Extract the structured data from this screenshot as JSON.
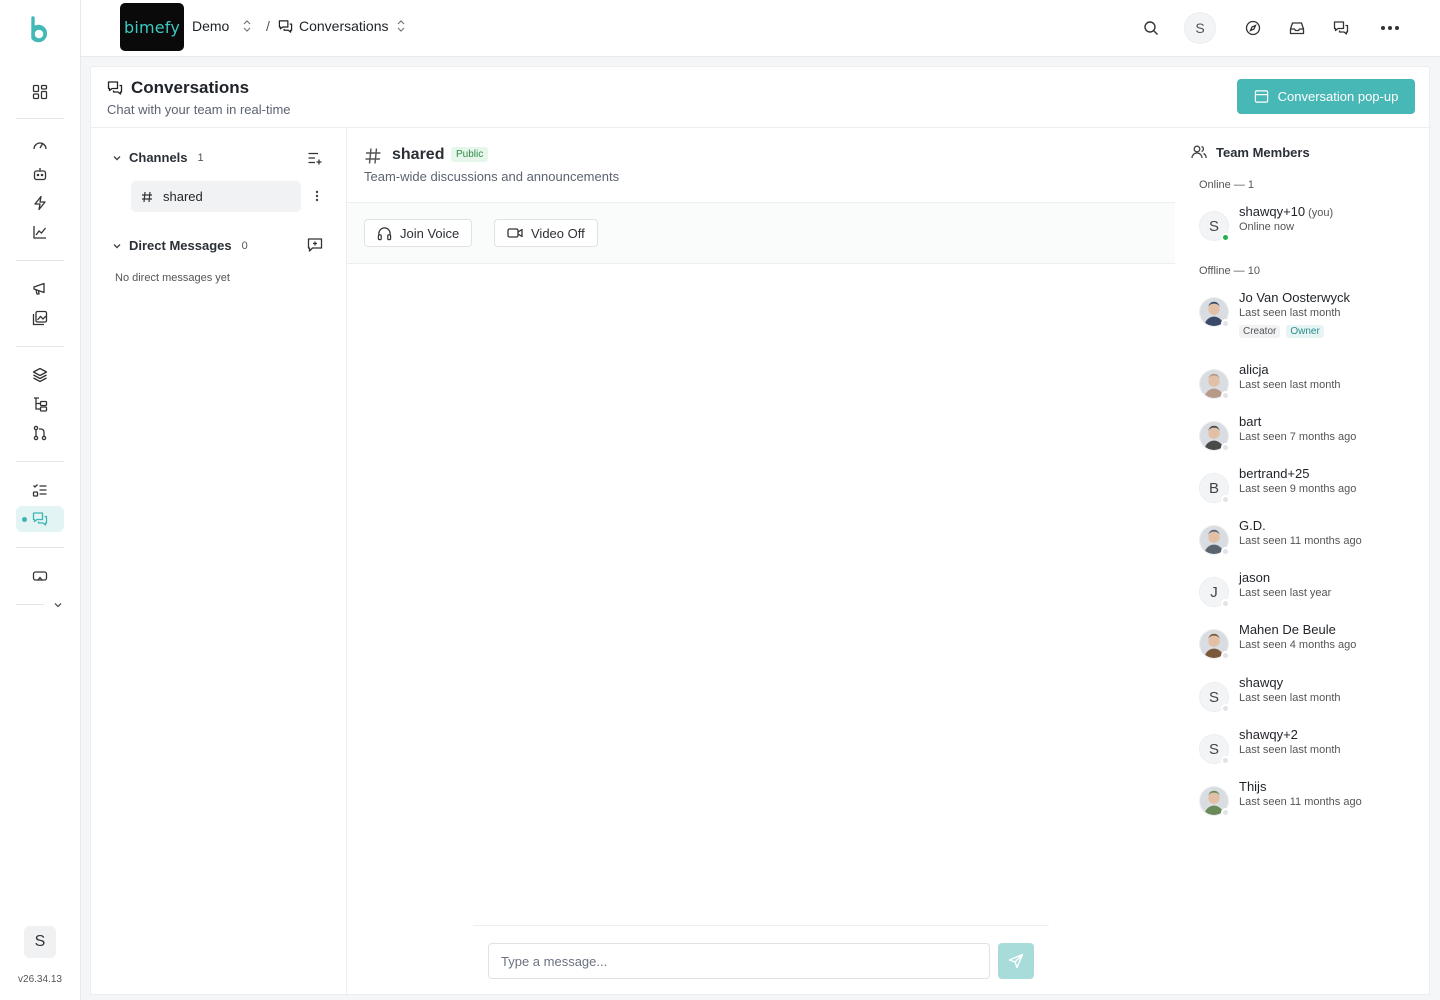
{
  "colors": {
    "accent": "#47b8b6",
    "online": "#22b14c"
  },
  "rail": {
    "logo_icon": "bimefy-b-logo-icon",
    "items": [
      "dashboard-grid-icon",
      "gauge-icon",
      "robot-icon",
      "lightning-icon",
      "chart-line-icon",
      "megaphone-icon",
      "images-icon",
      "layers-icon",
      "tree-icon",
      "git-branch-icon",
      "checklist-icon",
      "chat-bubbles-icon",
      "vr-headset-icon",
      "chevron-down-icon"
    ],
    "user_initial": "S",
    "version": "v26.34.13"
  },
  "topbar": {
    "brand_text": "bimefy",
    "project": "Demo",
    "separator": "/",
    "section": "Conversations",
    "avatar_initial": "S"
  },
  "page": {
    "title": "Conversations",
    "subtitle": "Chat with your team in real-time",
    "popup_button": "Conversation pop-up"
  },
  "channels": {
    "heading": "Channels",
    "count": "1",
    "items": [
      {
        "name": "shared"
      }
    ],
    "dm_heading": "Direct Messages",
    "dm_count": "0",
    "dm_empty": "No direct messages yet"
  },
  "channel": {
    "name": "shared",
    "badge": "Public",
    "description": "Team-wide discussions and announcements",
    "join_voice": "Join Voice",
    "video": "Video Off",
    "input_placeholder": "Type a message..."
  },
  "members": {
    "title": "Team Members",
    "online_label": "Online — 1",
    "offline_label": "Offline — 10",
    "online": [
      {
        "initial": "S",
        "name": "shawqy+10",
        "you": "(you)",
        "status": "Online now"
      }
    ],
    "offline": [
      {
        "name": "Jo Van Oosterwyck",
        "status": "Last seen last month",
        "tags": [
          "Creator",
          "Owner"
        ],
        "photo": true
      },
      {
        "name": "alicja",
        "status": "Last seen last month",
        "photo": true
      },
      {
        "name": "bart",
        "status": "Last seen 7 months ago",
        "photo": true
      },
      {
        "initial": "B",
        "name": "bertrand+25",
        "status": "Last seen 9 months ago"
      },
      {
        "name": "G.D.",
        "status": "Last seen 11 months ago",
        "photo": true
      },
      {
        "initial": "J",
        "name": "jason",
        "status": "Last seen last year"
      },
      {
        "name": "Mahen De Beule",
        "status": "Last seen 4 months ago",
        "photo": true
      },
      {
        "initial": "S",
        "name": "shawqy",
        "status": "Last seen last month"
      },
      {
        "initial": "S",
        "name": "shawqy+2",
        "status": "Last seen last month"
      },
      {
        "name": "Thijs",
        "status": "Last seen 11 months ago",
        "photo": true
      }
    ]
  }
}
